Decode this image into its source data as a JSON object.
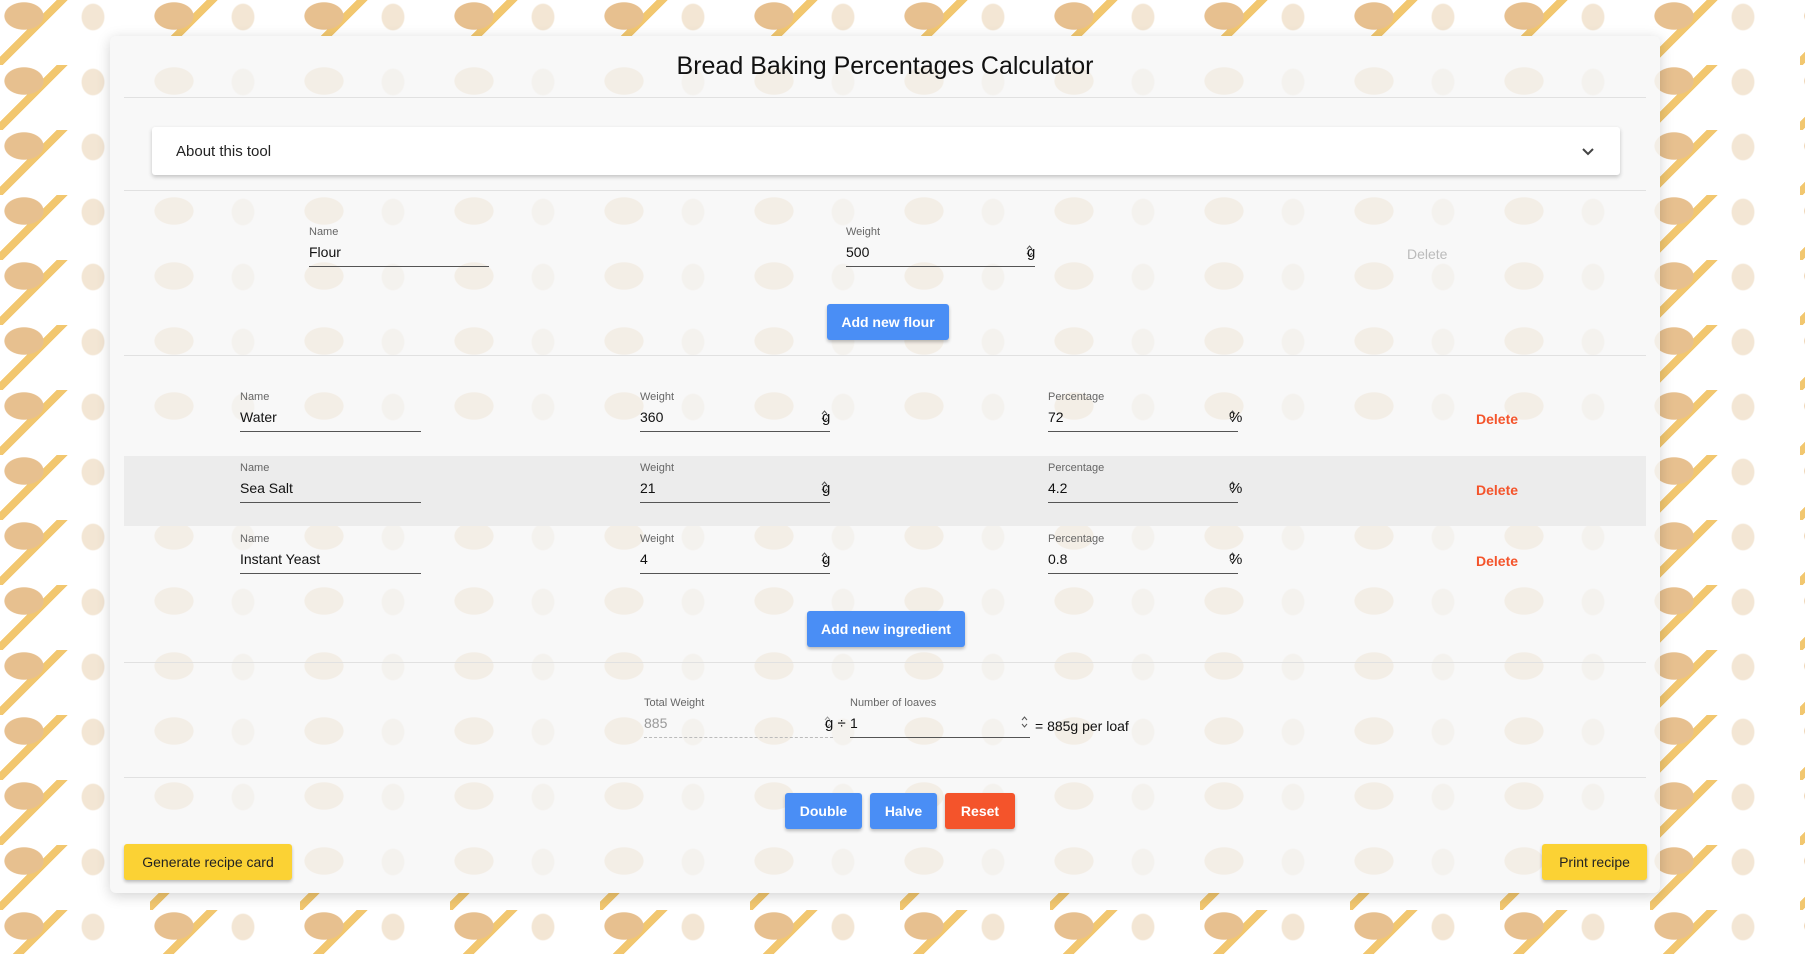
{
  "title": "Bread Baking Percentages Calculator",
  "about": {
    "label": "About this tool"
  },
  "flours": [
    {
      "name_label": "Name",
      "name": "Flour",
      "weight_label": "Weight",
      "weight": "500",
      "unit": "g",
      "delete": "Delete"
    }
  ],
  "add_flour_label": "Add new flour",
  "ingredients": [
    {
      "name_label": "Name",
      "name": "Water",
      "weight_label": "Weight",
      "weight": "360",
      "unit": "g",
      "pct_label": "Percentage",
      "pct": "72",
      "pct_unit": "%",
      "delete": "Delete"
    },
    {
      "name_label": "Name",
      "name": "Sea Salt",
      "weight_label": "Weight",
      "weight": "21",
      "unit": "g",
      "pct_label": "Percentage",
      "pct": "4.2",
      "pct_unit": "%",
      "delete": "Delete"
    },
    {
      "name_label": "Name",
      "name": "Instant Yeast",
      "weight_label": "Weight",
      "weight": "4",
      "unit": "g",
      "pct_label": "Percentage",
      "pct": "0.8",
      "pct_unit": "%",
      "delete": "Delete"
    }
  ],
  "add_ingredient_label": "Add new ingredient",
  "totals": {
    "total_label": "Total Weight",
    "total": "885",
    "unit": "g ÷",
    "loaves_label": "Number of loaves",
    "loaves": "1",
    "result": "= 885g per loaf"
  },
  "actions": {
    "double": "Double",
    "halve": "Halve",
    "reset": "Reset"
  },
  "footer": {
    "generate": "Generate recipe card",
    "print": "Print recipe"
  },
  "colors": {
    "blue": "#4a8ef5",
    "orange": "#f4542b",
    "yellow": "#fbd234"
  }
}
